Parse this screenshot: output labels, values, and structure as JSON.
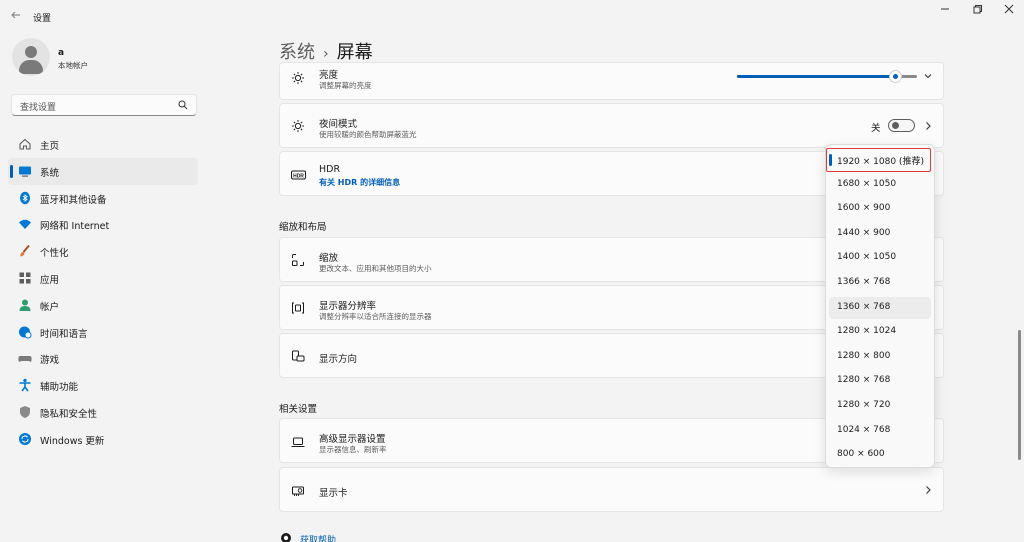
{
  "window": {
    "title": "设置",
    "back_icon": "arrow-left-icon",
    "controls": [
      "minimize-icon",
      "maximize-icon",
      "close-icon"
    ]
  },
  "profile": {
    "name": "a",
    "account_type": "本地帐户"
  },
  "search": {
    "placeholder": "查找设置",
    "icon": "search-icon"
  },
  "sidebar": {
    "items": [
      {
        "label": "主页",
        "icon": "home-icon",
        "active": false
      },
      {
        "label": "系统",
        "icon": "monitor-icon",
        "active": true
      },
      {
        "label": "蓝牙和其他设备",
        "icon": "bluetooth-icon",
        "active": false
      },
      {
        "label": "网络和 Internet",
        "icon": "wifi-icon",
        "active": false
      },
      {
        "label": "个性化",
        "icon": "brush-icon",
        "active": false
      },
      {
        "label": "应用",
        "icon": "apps-icon",
        "active": false
      },
      {
        "label": "帐户",
        "icon": "person-icon",
        "active": false
      },
      {
        "label": "时间和语言",
        "icon": "globe-clock-icon",
        "active": false
      },
      {
        "label": "游戏",
        "icon": "gamepad-icon",
        "active": false
      },
      {
        "label": "辅助功能",
        "icon": "accessibility-icon",
        "active": false
      },
      {
        "label": "隐私和安全性",
        "icon": "shield-icon",
        "active": false
      },
      {
        "label": "Windows 更新",
        "icon": "update-icon",
        "active": false
      }
    ]
  },
  "header": {
    "parent": "系统",
    "separator": "›",
    "title": "屏幕"
  },
  "brightness": {
    "title": "亮度",
    "subtitle": "调整屏幕的亮度",
    "value_percent": 88
  },
  "night_light": {
    "title": "夜间模式",
    "subtitle": "使用较暖的颜色帮助屏蔽蓝光",
    "state_label": "关",
    "on": false
  },
  "hdr": {
    "title": "HDR",
    "link": "有关 HDR 的详细信息"
  },
  "scale_section": {
    "title": "缩放和布局"
  },
  "scale": {
    "title": "缩放",
    "subtitle": "更改文本、应用和其他项目的大小"
  },
  "resolution": {
    "title": "显示器分辨率",
    "subtitle": "调整分辨率以适合所连接的显示器"
  },
  "orientation": {
    "title": "显示方向"
  },
  "related_section": {
    "title": "相关设置"
  },
  "advanced_display": {
    "title": "高级显示器设置",
    "subtitle": "显示器信息、刷新率"
  },
  "graphics": {
    "title": "显示卡"
  },
  "help": {
    "label": "获取帮助"
  },
  "resolution_dropdown": {
    "selected_index": 0,
    "hover_index": 6,
    "options": [
      "1920 × 1080 (推荐)",
      "1680 × 1050",
      "1600 × 900",
      "1440 × 900",
      "1400 × 1050",
      "1366 × 768",
      "1360 × 768",
      "1280 × 1024",
      "1280 × 800",
      "1280 × 768",
      "1280 × 720",
      "1024 × 768",
      "800 × 600"
    ]
  },
  "colors": {
    "accent": "#005fb8",
    "highlight": "#e23a2e"
  }
}
